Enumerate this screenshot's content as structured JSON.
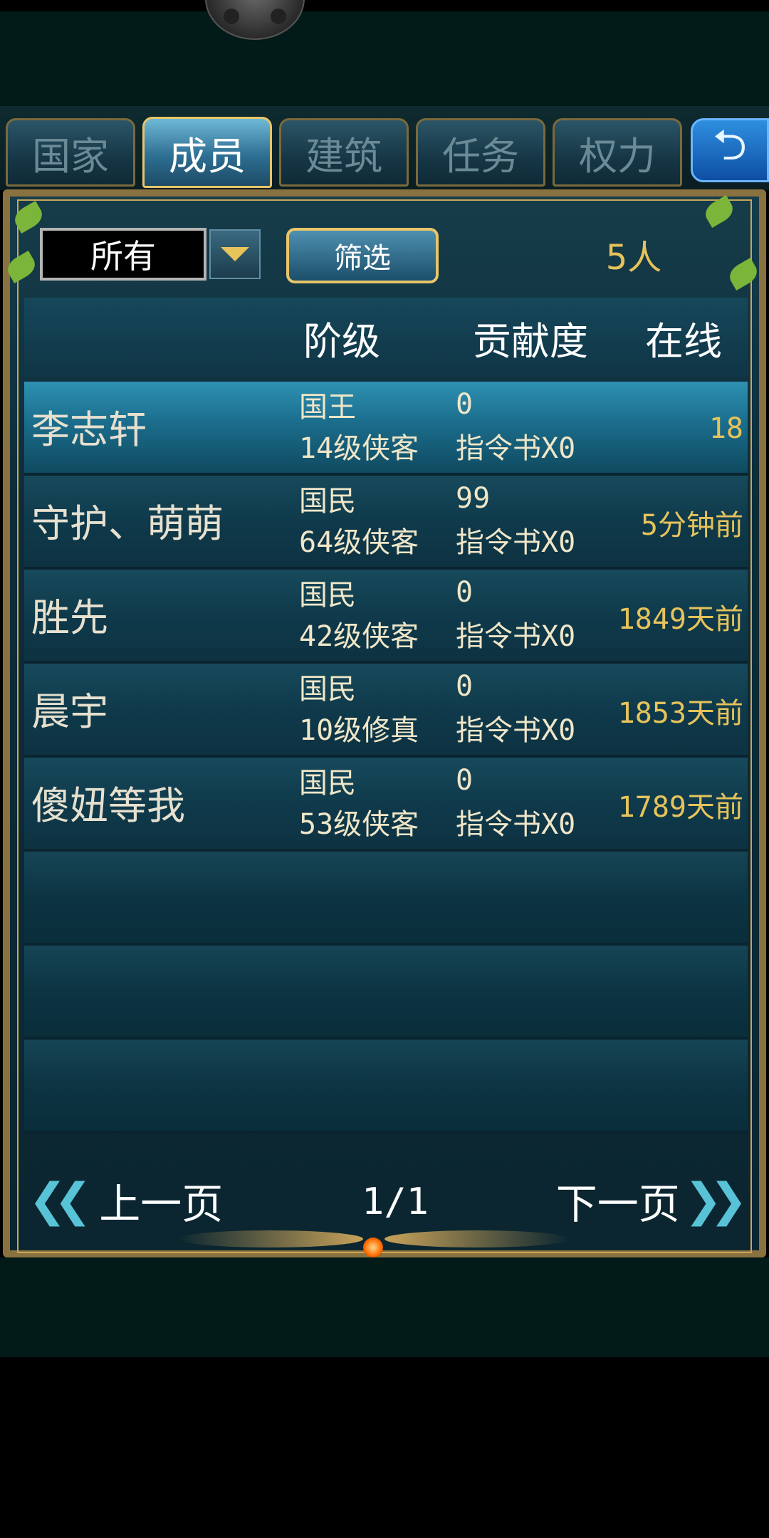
{
  "tabs": [
    {
      "label": "国家",
      "active": false
    },
    {
      "label": "成员",
      "active": true
    },
    {
      "label": "建筑",
      "active": false
    },
    {
      "label": "任务",
      "active": false
    },
    {
      "label": "权力",
      "active": false
    }
  ],
  "back_icon": "return-arrow-icon",
  "filter": {
    "selected": "所有",
    "button_label": "筛选",
    "count": "5人"
  },
  "table": {
    "headers": [
      "",
      "阶级",
      "贡献度",
      "在线"
    ],
    "rows": [
      {
        "name": "李志轩",
        "rank": "国王",
        "level": "14级侠客",
        "contribution": "0",
        "orders": "指令书X0",
        "online": "18",
        "selected": true
      },
      {
        "name": "守护、萌萌",
        "rank": "国民",
        "level": "64级侠客",
        "contribution": "99",
        "orders": "指令书X0",
        "online": "5分钟前",
        "selected": false
      },
      {
        "name": "胜先",
        "rank": "国民",
        "level": "42级侠客",
        "contribution": "0",
        "orders": "指令书X0",
        "online": "1849天前",
        "selected": false
      },
      {
        "name": "晨宇",
        "rank": "国民",
        "level": "10级修真",
        "contribution": "0",
        "orders": "指令书X0",
        "online": "1853天前",
        "selected": false
      },
      {
        "name": "傻妞等我",
        "rank": "国民",
        "level": "53级侠客",
        "contribution": "0",
        "orders": "指令书X0",
        "online": "1789天前",
        "selected": false
      }
    ]
  },
  "pagination": {
    "prev_label": "上一页",
    "next_label": "下一页",
    "page": "1/1"
  },
  "colors": {
    "accent_gold": "#e6c35b",
    "panel_border": "#8a7240",
    "active_tab": "#2e6f93",
    "selected_row": "#1b6d8c"
  }
}
